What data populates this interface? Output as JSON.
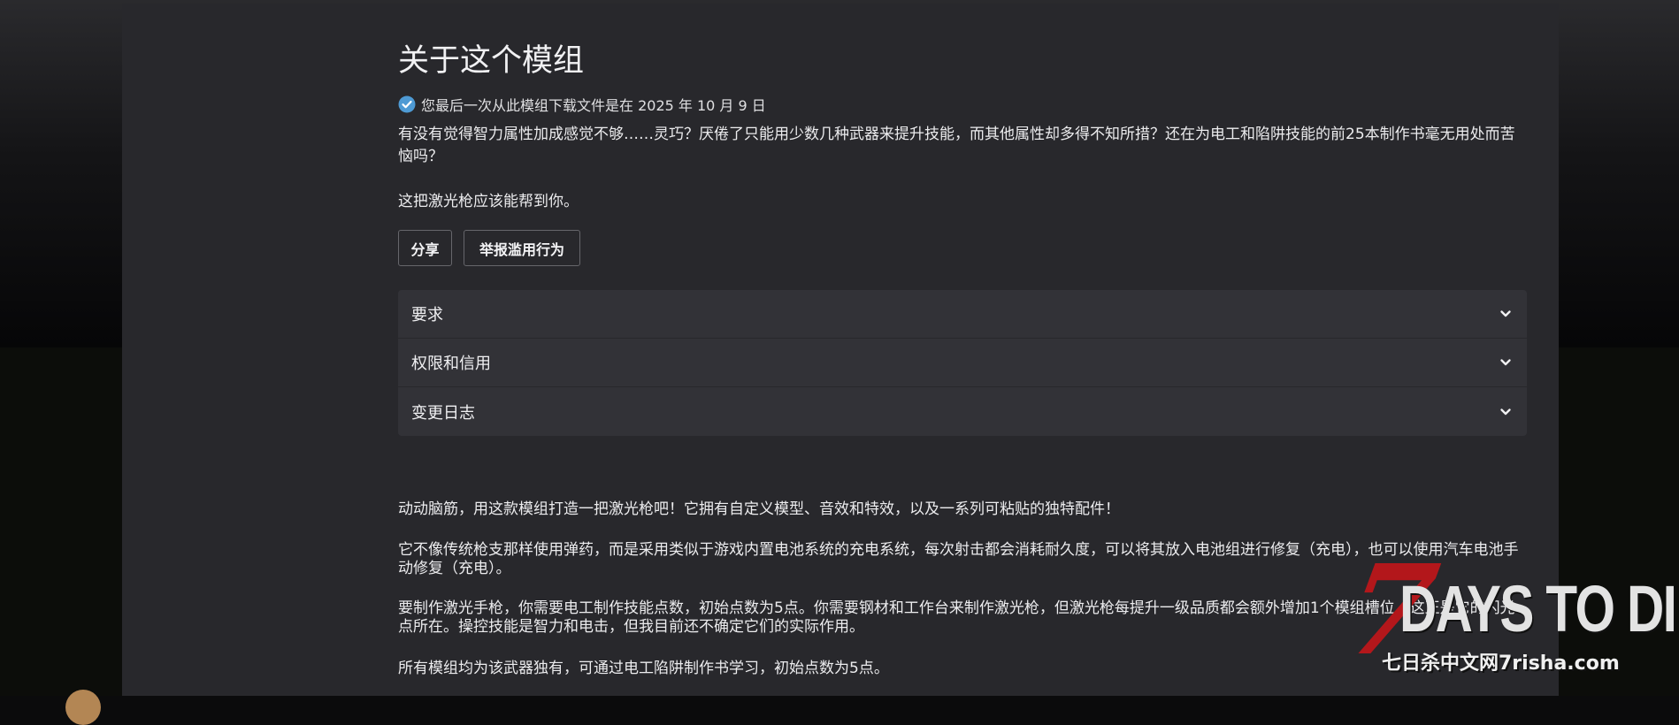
{
  "page": {
    "title": "关于这个模组",
    "download_notice": "您最后一次从此模组下载文件是在 2025 年 10 月 9 日",
    "intro": "有没有觉得智力属性加成感觉不够……灵巧？厌倦了只能用少数几种武器来提升技能，而其他属性却多得不知所措？还在为电工和陷阱技能的前25本制作书毫无用处而苦恼吗？",
    "help_text": "这把激光枪应该能帮到你。"
  },
  "actions": {
    "share_label": "分享",
    "report_label": "举报滥用行为"
  },
  "accordion": [
    {
      "label": "要求"
    },
    {
      "label": "权限和信用"
    },
    {
      "label": "变更日志"
    }
  ],
  "description": [
    "动动脑筋，用这款模组打造一把激光枪吧！它拥有自定义模型、音效和特效，以及一系列可粘贴的独特配件！",
    "它不像传统枪支那样使用弹药，而是采用类似于游戏内置电池系统的充电系统，每次射击都会消耗耐久度，可以将其放入电池组进行修复（充电），也可以使用汽车电池手动修复（充电）。",
    "要制作激光手枪，你需要电工制作技能点数，初始点数为5点。你需要钢材和工作台来制作激光枪，但激光枪每提升一级品质都会额外增加1个模组槽位，这正是它的闪光点所在。操控技能是智力和电击，但我目前还不确定它们的实际作用。",
    "所有模组均为该武器独有，可通过电工陷阱制作书学习，初始点数为5点。"
  ],
  "watermark": {
    "digit": "7",
    "main": "DAYS TO DIE",
    "sub": "七日杀中文网7risha.com"
  },
  "colors": {
    "panel": "#28282c",
    "accordion": "#323237",
    "check": "#4e9ad4",
    "logo_red": "#b3171b"
  },
  "icons": {
    "download_check": "check-circle-icon",
    "accordion_toggle": "chevron-down-icon"
  }
}
